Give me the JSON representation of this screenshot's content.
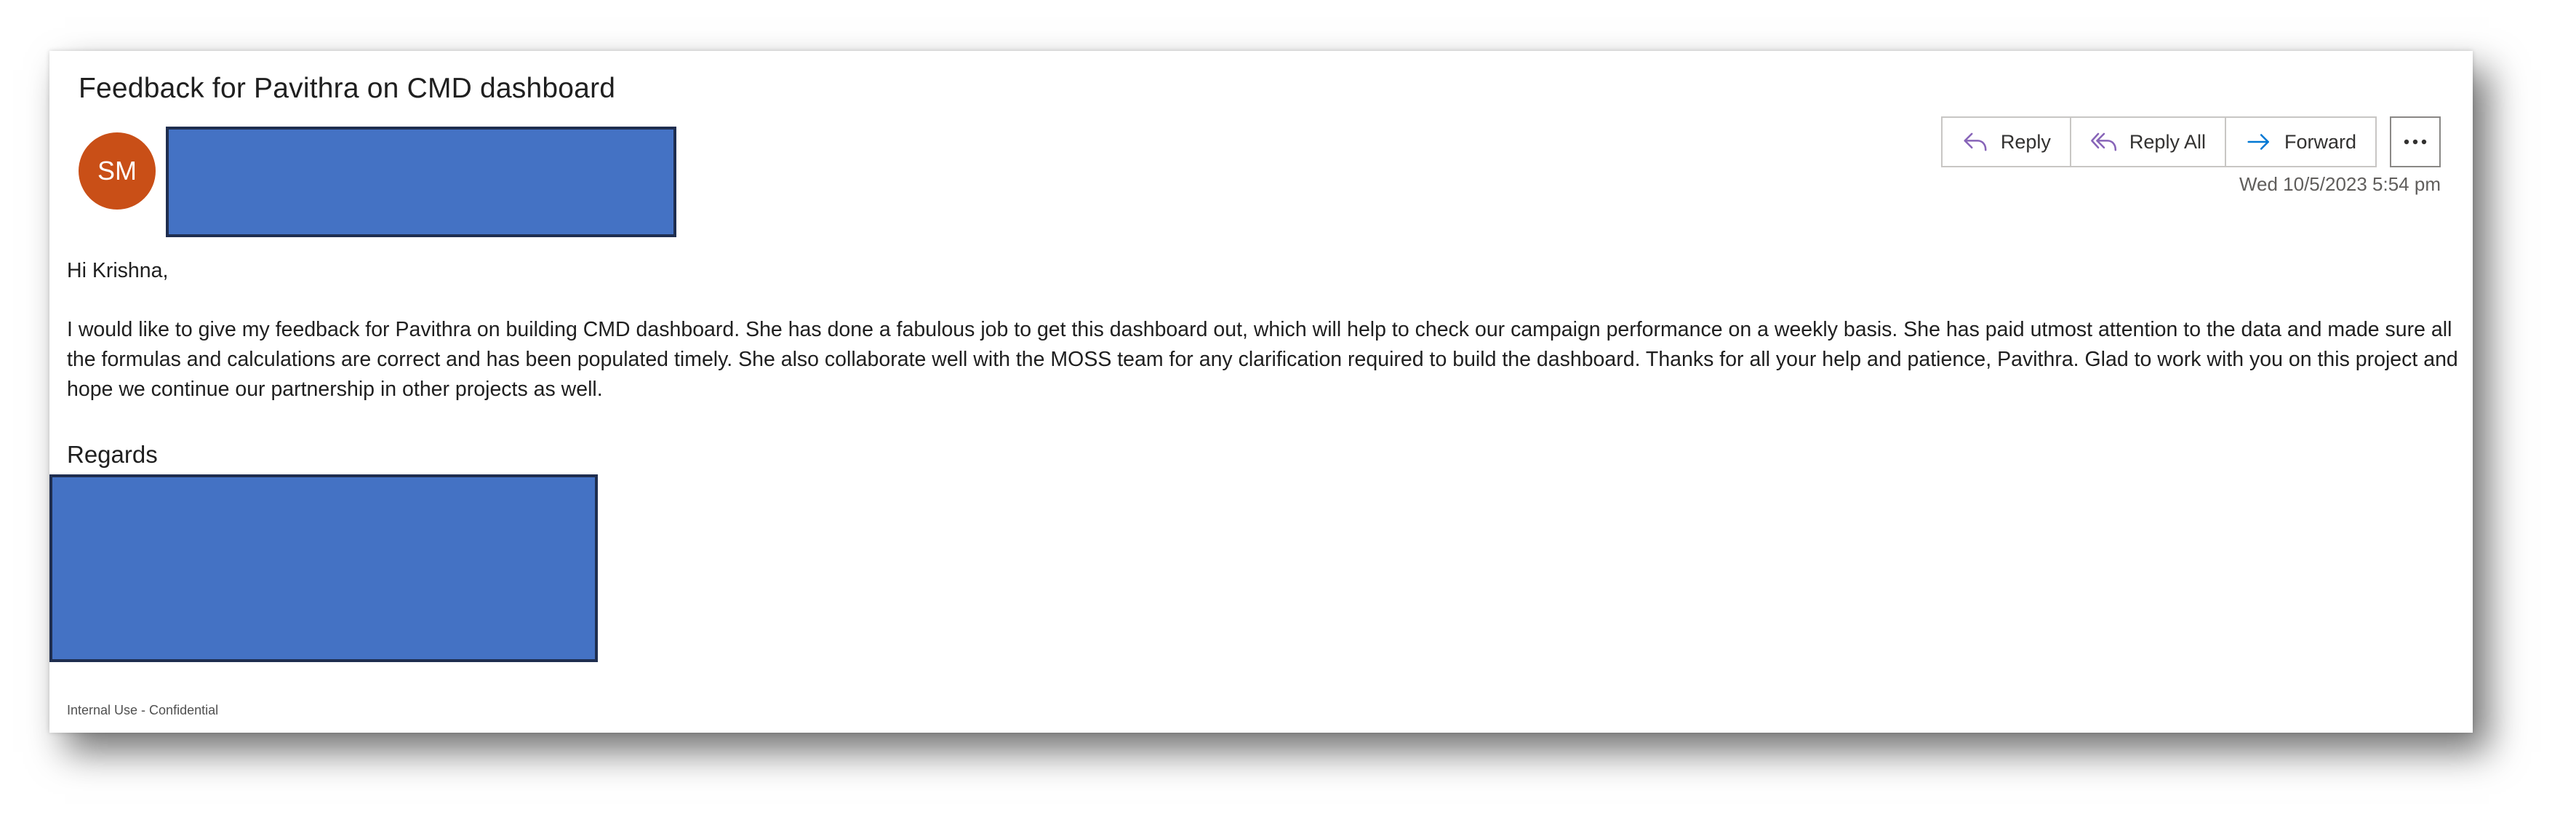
{
  "email": {
    "subject": "Feedback for Pavithra on CMD dashboard",
    "sender_initials": "SM",
    "date": "Wed 10/5/2023 5:54 pm",
    "greeting": "Hi Krishna,",
    "body": "I would like to give my feedback for Pavithra on building CMD dashboard. She has done a fabulous job to get this dashboard out, which will help to check our campaign performance on a weekly basis. She has paid utmost attention to the data and made sure all the formulas and calculations are correct and has been populated timely. She also collaborate well with the MOSS team for any clarification required to build the dashboard. Thanks for all your help and patience, Pavithra. Glad to work with you on this project and hope we continue our partnership in other projects as well.",
    "closing": "Regards",
    "footer": "Internal Use - Confidential"
  },
  "actions": {
    "reply_label": "Reply",
    "reply_all_label": "Reply All",
    "forward_label": "Forward"
  },
  "colors": {
    "avatar_bg": "#c94f17",
    "redaction": "#4472c4",
    "reply_icon": "#8764b8",
    "forward_icon": "#0078d4"
  },
  "icons": {
    "reply": "reply-arrow-icon",
    "reply_all": "reply-all-arrow-icon",
    "forward": "forward-arrow-icon",
    "more": "ellipsis-icon"
  }
}
